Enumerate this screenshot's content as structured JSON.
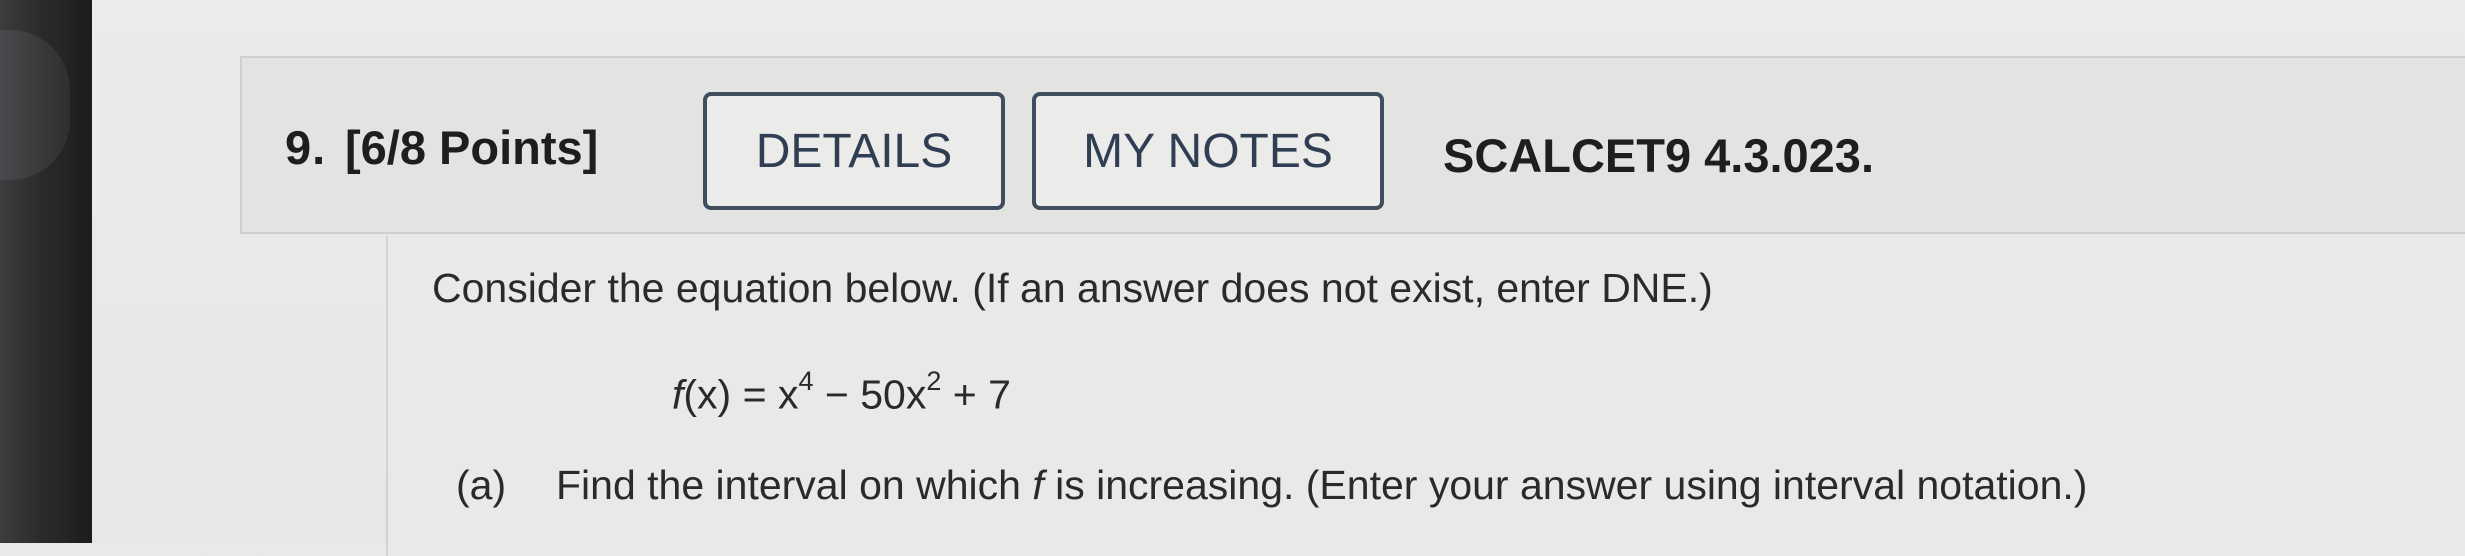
{
  "header": {
    "number": "9.",
    "points": "[6/8 Points]",
    "details_label": "DETAILS",
    "notes_label": "MY NOTES",
    "source": "SCALCET9 4.3.023."
  },
  "body": {
    "prompt": "Consider the equation below. (If an answer does not exist, enter DNE.)",
    "equation": {
      "fn": "f",
      "lhs_rest": "(x) = x",
      "exp1": "4",
      "middle": " − 50x",
      "exp2": "2",
      "tail": " + 7"
    },
    "part_a": {
      "label": "(a)",
      "text_before": "Find the interval on which ",
      "var": "f",
      "text_after": " is increasing. (Enter your answer using interval notation.)"
    }
  }
}
